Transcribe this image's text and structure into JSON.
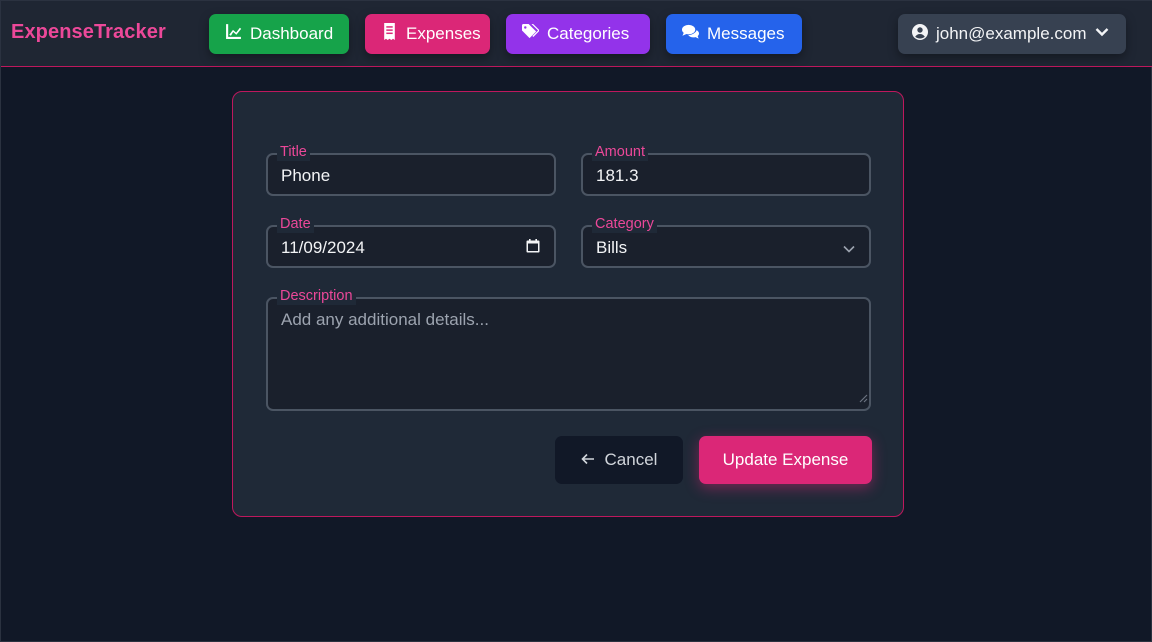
{
  "app": {
    "brand": "ExpenseTracker"
  },
  "nav": {
    "dashboard": {
      "label": "Dashboard",
      "icon": "chart-line-icon",
      "color": "#16a34a"
    },
    "expenses": {
      "label": "Expenses",
      "icon": "receipt-icon",
      "color": "#db2777"
    },
    "categories": {
      "label": "Categories",
      "icon": "tags-icon",
      "color": "#9333ea"
    },
    "messages": {
      "label": "Messages",
      "icon": "comments-icon",
      "color": "#2563eb"
    }
  },
  "user": {
    "email": "john@example.com",
    "icon": "user-circle-icon"
  },
  "form": {
    "title": {
      "label": "Title",
      "value": "Phone"
    },
    "amount": {
      "label": "Amount",
      "value": "181.3"
    },
    "date": {
      "label": "Date",
      "value": "11/09/2024"
    },
    "category": {
      "label": "Category",
      "selected": "Bills"
    },
    "description": {
      "label": "Description",
      "value": "",
      "placeholder": "Add any additional details..."
    },
    "cancel_label": "Cancel",
    "submit_label": "Update Expense"
  },
  "colors": {
    "accent": "#ec4899",
    "background": "#111827",
    "card": "#1f2937"
  }
}
